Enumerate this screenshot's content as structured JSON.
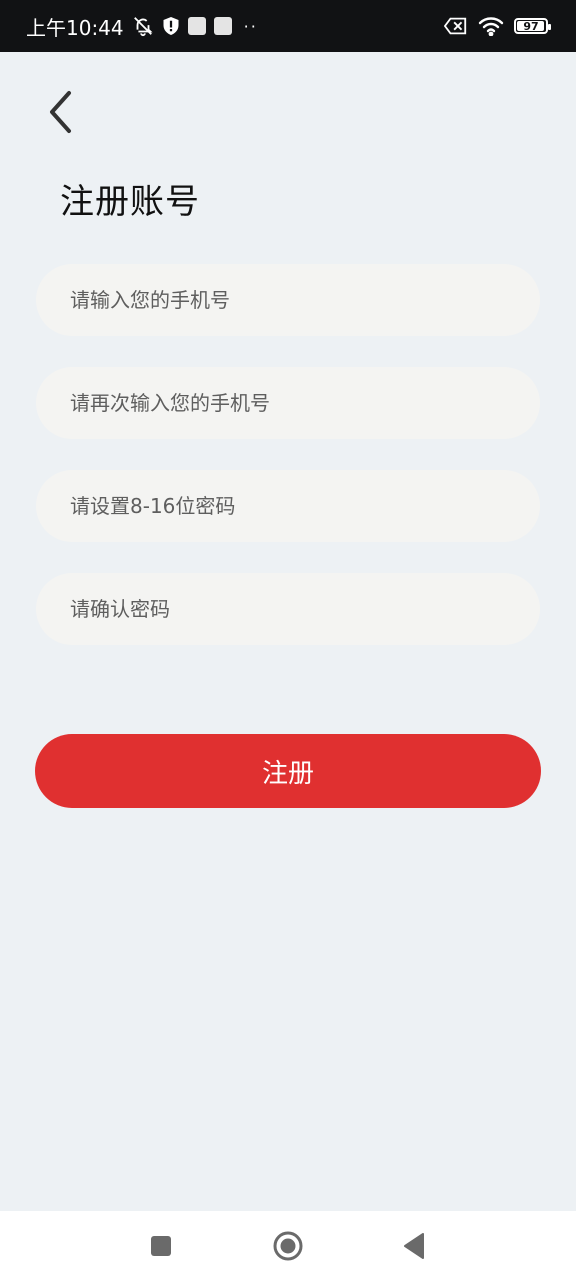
{
  "status_bar": {
    "time": "上午10:44",
    "battery": "97",
    "battery_level": 0.97,
    "icons": [
      "bell-off-icon",
      "shield-alert-icon",
      "notification-square-icon",
      "notification-square-icon",
      "more-dots-icon",
      "sim-error-icon",
      "wifi-icon",
      "battery-icon"
    ]
  },
  "header": {
    "back_icon": "chevron-left-icon",
    "title": "注册账号"
  },
  "form": {
    "phone_placeholder": "请输入您的手机号",
    "phone_confirm_placeholder": "请再次输入您的手机号",
    "password_placeholder": "请设置8-16位密码",
    "password_confirm_placeholder": "请确认密码",
    "submit_label": "注册"
  },
  "navigation": {
    "icons": [
      "recent-apps-icon",
      "home-icon",
      "back-triangle-icon"
    ]
  },
  "colors": {
    "accent": "#e03030",
    "background": "#edf1f4",
    "field_bg": "#f4f4f2",
    "status_bar_bg": "#111214"
  }
}
